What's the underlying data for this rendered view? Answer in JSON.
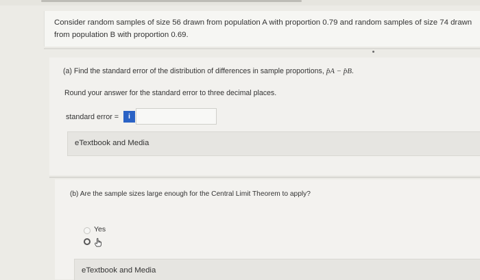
{
  "problem": {
    "text": "Consider random samples of size 56 drawn from population A with proportion 0.79 and random samples of size 74 drawn from population B with proportion 0.69."
  },
  "part_a": {
    "question": "(a) Find the standard error of the distribution of differences in sample proportions,",
    "question_math": "p̂A − p̂B",
    "round_text": "Round your answer for the standard error to three decimal places.",
    "se_label": "standard error =",
    "info_icon": "i",
    "se_value": "",
    "etextbook_label": "eTextbook and Media"
  },
  "part_b": {
    "question": "(b) Are the sample sizes large enough for the Central Limit Theorem to apply?",
    "options": [
      "Yes",
      "No"
    ],
    "etextbook_label": "eTextbook and Media"
  }
}
